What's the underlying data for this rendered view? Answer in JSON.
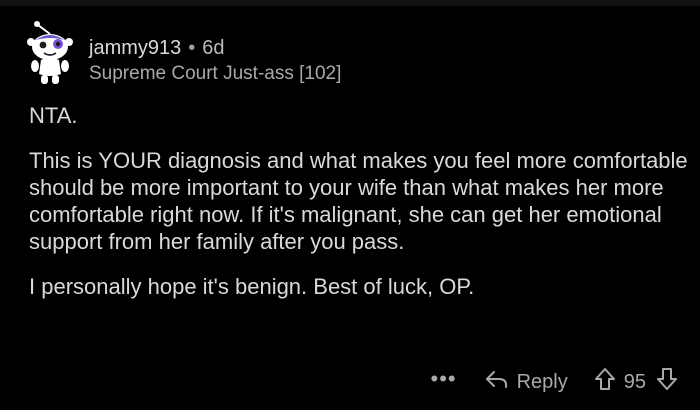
{
  "comment": {
    "author": "jammy913",
    "separator": "•",
    "age": "6d",
    "flair": "Supreme Court Just-ass [102]",
    "paragraphs": [
      "NTA.",
      "This is YOUR diagnosis and what makes you feel more comfortable should be more important to your wife than what makes her more comfortable right now.  If it's malignant, she can get her emotional support from her family after you pass.",
      "I personally hope it's benign. Best of luck, OP."
    ]
  },
  "actions": {
    "more_label": "•••",
    "reply_label": "Reply",
    "vote_count": "95"
  },
  "colors": {
    "background": "#000000",
    "text": "#d7dadc",
    "muted": "#a7aaad"
  },
  "icons": {
    "avatar": "snoo-avatar",
    "reply": "reply-arrow-icon",
    "upvote": "upvote-arrow-icon",
    "downvote": "downvote-arrow-icon"
  }
}
